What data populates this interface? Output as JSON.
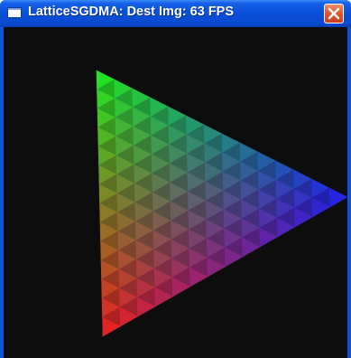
{
  "window": {
    "title": "LatticeSGDMA: Dest Img: 63 FPS"
  },
  "icons": {
    "app": "window-icon",
    "close": "close-x-icon"
  },
  "canvas": {
    "background": "#0d0d0d",
    "triangle": {
      "grid_subdivisions": 14,
      "vertex_colors": {
        "top": "#22ff22",
        "right": "#2222ff",
        "bottom": "#ff2222"
      }
    }
  }
}
